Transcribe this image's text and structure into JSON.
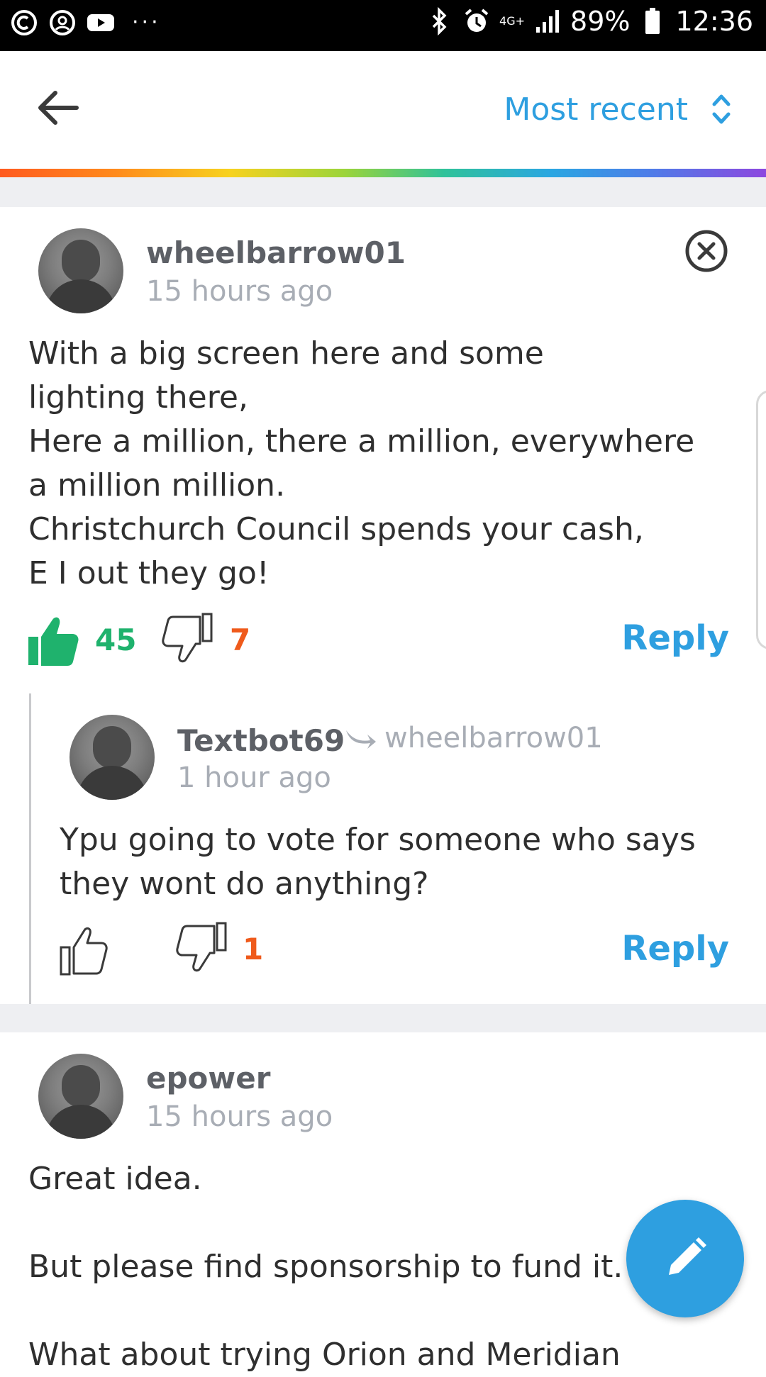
{
  "status_bar": {
    "battery": "89%",
    "time": "12:36",
    "network": "4G+",
    "more": "···"
  },
  "header": {
    "sort_label": "Most recent"
  },
  "comments": [
    {
      "username": "wheelbarrow01",
      "time": "15 hours ago",
      "text": "With a big screen here and some\nlighting there,\nHere a million, there a million, everywhere\na million million.\nChristchurch Council spends your cash,\nE I out they go!",
      "likes": "45",
      "dislikes": "7",
      "reply_label": "Reply",
      "liked": true
    },
    {
      "username": "Textbot69",
      "reply_to": "wheelbarrow01",
      "time": "1 hour ago",
      "text": "Ypu going to vote for someone who says\nthey wont do anything?",
      "likes": "",
      "dislikes": "1",
      "reply_label": "Reply",
      "liked": false
    },
    {
      "username": "epower",
      "time": "15 hours ago",
      "text": "Great idea.\n\nBut please find sponsorship to fund it.\n\nWhat about trying Orion and Meridian",
      "reply_label": "Reply"
    }
  ],
  "colors": {
    "accent": "#2e9fe0",
    "like": "#1fb26d",
    "dislike": "#ef5a1b"
  },
  "icons": {
    "back": "arrow-left-icon",
    "sort": "chevron-up-down-icon",
    "close": "close-circle-icon",
    "like": "thumbs-up-icon",
    "dislike": "thumbs-down-icon",
    "reply_to": "reply-arrow-icon",
    "compose": "pencil-icon"
  }
}
